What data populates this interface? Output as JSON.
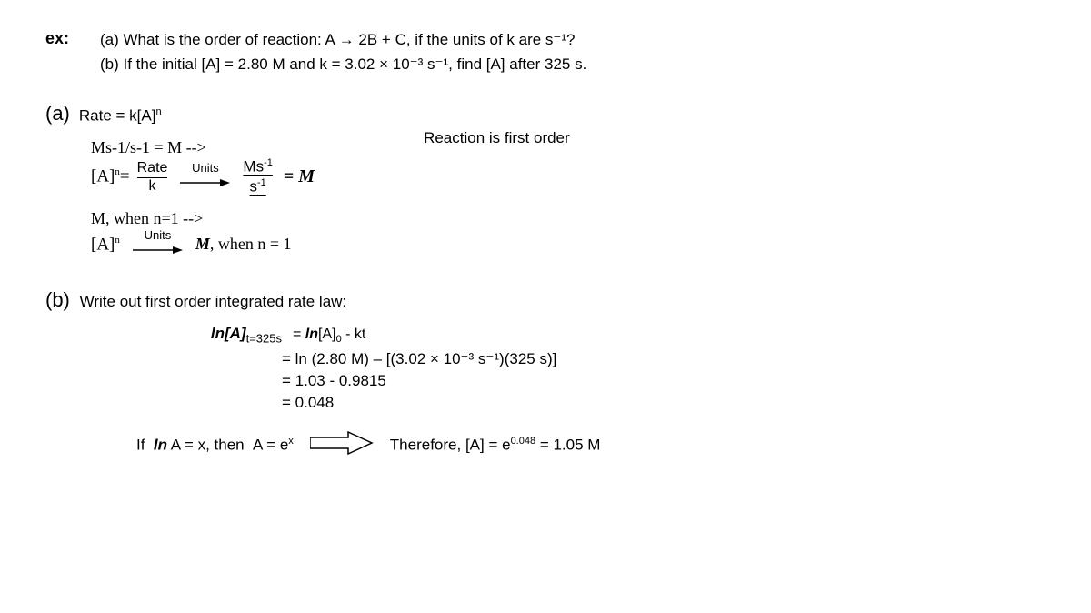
{
  "ex_label": "ex:",
  "intro": {
    "line1": "(a) What is the order of reaction: A → 2B + C, if the units of k are s⁻¹?",
    "line2": "(b) If the initial [A] = 2.80 M and k = 3.02 × 10⁻³ s⁻¹, find [A] after 325 s."
  },
  "part_a": {
    "label": "(a)",
    "equation": "Rate = k[A]ⁿ",
    "fraction_label": "[A]ⁿ=",
    "numerator": "Rate",
    "denominator": "k",
    "units_label": "Units",
    "ms_numerator": "Ms⁻¹",
    "ms_denominator": "s⁻¹",
    "result": "= M",
    "reaction_note": "Reaction is first order",
    "units_line": "Units",
    "arr_result": "→  M, when n = 1"
  },
  "part_b": {
    "label": "(b)",
    "description": "Write out first order integrated rate law:",
    "lhs": "ln[A]",
    "lhs_sub": "t=325s",
    "rhs1": "= ln[A]₀ - kt",
    "rhs2": "= ln (2.80 M) – [(3.02 × 10⁻³ s⁻¹)(325 s)]",
    "rhs3": "= 1.03 - 0.9815",
    "rhs4": "= 0.048",
    "if_text": "If  ln A = x, then  A = e",
    "if_sup": "x",
    "therefore": "Therefore, [A] = e",
    "therefore_sup": "0.048",
    "therefore_end": "= 1.05 M"
  }
}
